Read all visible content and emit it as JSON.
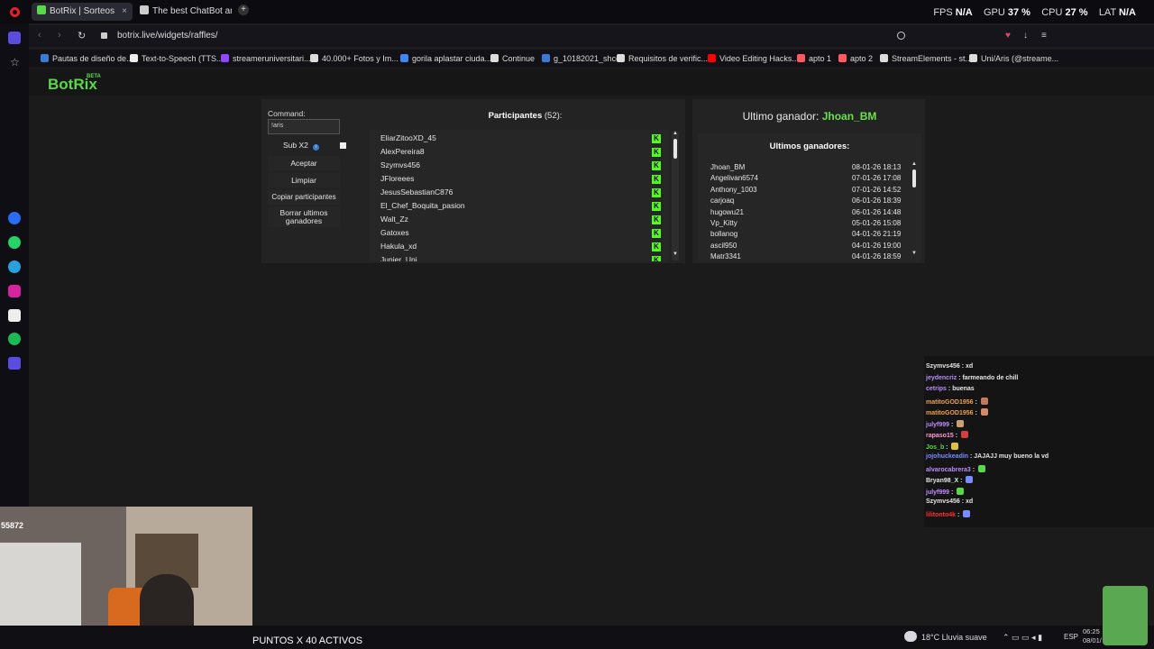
{
  "browser": {
    "tabs": [
      {
        "label": "BotRix | Sorteos",
        "active": true
      },
      {
        "label": "The best ChatBot and Wid",
        "active": false
      }
    ],
    "new_tab_label": "+",
    "stats": {
      "fps_label": "FPS",
      "fps_value": "N/A",
      "gpu_label": "GPU",
      "gpu_value": "37 %",
      "cpu_label": "CPU",
      "cpu_value": "27 %",
      "lat_label": "LAT",
      "lat_value": "N/A"
    },
    "url": "botrix.live/widgets/raffles/",
    "bookmarks": [
      {
        "label": "Pautas de diseño de...",
        "color": "#3a7bd5"
      },
      {
        "label": "Text-to-Speech (TTS...",
        "color": "#eeeeee"
      },
      {
        "label": "streameruniversitari...",
        "color": "#9146ff"
      },
      {
        "label": "40.000+ Fotos y Im...",
        "color": "#dddddd"
      },
      {
        "label": "gorila aplastar ciuda...",
        "color": "#4285f4"
      },
      {
        "label": "Continue",
        "color": "#dddddd"
      },
      {
        "label": "g_10182021_shcc",
        "color": "#3a7bd5"
      },
      {
        "label": "Requisitos de verific...",
        "color": "#dddddd"
      },
      {
        "label": "Video Editing Hacks...",
        "color": "#ff0000"
      },
      {
        "label": "apto 1",
        "color": "#ff5a5f"
      },
      {
        "label": "apto 2",
        "color": "#ff5a5f"
      },
      {
        "label": "StreamElements - st...",
        "color": "#dddddd"
      },
      {
        "label": "Uni/Aris (@streame...",
        "color": "#dddddd"
      }
    ]
  },
  "app": {
    "logo": "BotRix",
    "logo_badge": "BETA",
    "command_label": "Command:",
    "command_value": "!aris",
    "sub_label": "Sub X2",
    "buttons": {
      "accept": "Aceptar",
      "clear": "Limpiar",
      "copy": "Copiar participantes",
      "delete_line1": "Borrar ultimos",
      "delete_line2": "ganadores"
    },
    "participants_label": "Participantes",
    "participants_count": "(52):",
    "participants": [
      "EliarZitooXD_45",
      "AlexPereira8",
      "Szymvs456",
      "JFloreees",
      "JesusSebastianC876",
      "El_Chef_Boquita_pasion",
      "Walt_Zz",
      "Gatoxes",
      "Hakula_xd",
      "Junier_Uni"
    ],
    "platform_badge": "K",
    "last_winner_label": "Ultimo ganador:",
    "last_winner_name": "Jhoan_BM",
    "winners_title": "Ultimos ganadores:",
    "winners": [
      {
        "name": "Jhoan_BM",
        "date": "08-01-26 18:13"
      },
      {
        "name": "Angelivan6574",
        "date": "07-01-26 17:08"
      },
      {
        "name": "Anthony_1003",
        "date": "07-01-26 14:52"
      },
      {
        "name": "carjoaq",
        "date": "06-01-26 18:39"
      },
      {
        "name": "hugowu21",
        "date": "06-01-26 14:48"
      },
      {
        "name": "Vp_Kitty",
        "date": "05-01-26 15:08"
      },
      {
        "name": "bollanog",
        "date": "04-01-26 21:19"
      },
      {
        "name": "ascil950",
        "date": "04-01-26 19:00"
      },
      {
        "name": "Matr3341",
        "date": "04-01-26 18:59"
      }
    ]
  },
  "chat": [
    {
      "user": "Szymvs456",
      "text": " : xd",
      "color": "#e6e6e6",
      "emote": ""
    },
    {
      "user": "jeydencriz",
      "text": " : farmeando de chill",
      "color": "#b88bff",
      "emote": ""
    },
    {
      "user": "cetrips",
      "text": " : buenas",
      "color": "#b88bff",
      "emote": ""
    },
    {
      "user": "matitoGOD1956",
      "text": " : ",
      "color": "#f0a04b",
      "emote": "#c47a5a"
    },
    {
      "user": "matitoGOD1956",
      "text": " : ",
      "color": "#f0a04b",
      "emote": "#d38a6a"
    },
    {
      "user": "julyf999",
      "text": " : ",
      "color": "#c28bff",
      "emote": "#caa070"
    },
    {
      "user": "rapaso15",
      "text": " : ",
      "color": "#ff9ad5",
      "emote": "#d04040"
    },
    {
      "user": "Jos_b",
      "text": " : ",
      "color": "#59d94a",
      "emote": "#e0c040"
    },
    {
      "user": "jojohuckeadin",
      "text": " : JAJAJJ muy bueno la vd",
      "color": "#7a8cff",
      "emote": ""
    },
    {
      "user": "alvarocabrera3",
      "text": " : ",
      "color": "#b88bff",
      "emote": "#59d94a"
    },
    {
      "user": "Bryan98_X",
      "text": " : ",
      "color": "#e6e6e6",
      "emote": "#7a8cff"
    },
    {
      "user": "julyf999",
      "text": " : ",
      "color": "#c28bff",
      "emote": "#59d94a"
    },
    {
      "user": "Szymvs456",
      "text": " : xd",
      "color": "#e6e6e6",
      "emote": ""
    },
    {
      "user": "lilitonto4k",
      "text": " : ",
      "color": "#ff3030",
      "emote": "#7a8cff"
    }
  ],
  "stream": {
    "cam_count": "55872",
    "ticker": "PUNTOS X 40 ACTIVOS"
  },
  "taskbar": {
    "weather": "18°C  Lluvia suave",
    "lang": "ESP",
    "time": "06:25",
    "date": "08/01/"
  }
}
